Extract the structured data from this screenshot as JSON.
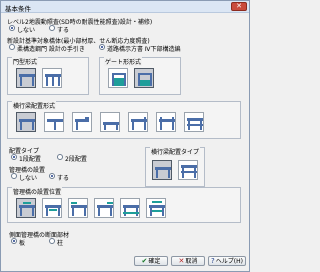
{
  "window": {
    "title": "基本条件",
    "close_glyph": "✕"
  },
  "level_check": {
    "label": "レベル2地震動照査(SD時の耐震性能照査)設計・補修)",
    "options": [
      "しない",
      "する"
    ],
    "selected": 0
  },
  "seismic": {
    "label": "新設計基準対象橋体(最小部材厚、せん断応力度照査)",
    "options": [
      "柔構造鋼門 設計の手引き",
      "道路橋示方書 Ⅳ下部構造編"
    ],
    "selected": 1
  },
  "pier_type": {
    "label": "門型形式"
  },
  "gate_type": {
    "label": "ゲート形形式"
  },
  "beam_type": {
    "label": "横行梁配置形式"
  },
  "haichi_type": {
    "label": "配置タイプ",
    "options": [
      "1段配置",
      "2段配置"
    ],
    "selected": 0
  },
  "beam_layout_type": {
    "label": "横行梁配置タイプ"
  },
  "beam_tube": {
    "label": "管理橋の設置",
    "options": [
      "しない",
      "する"
    ],
    "selected": 1
  },
  "beam_tube_pos": {
    "label": "管理橋の設置位置"
  },
  "side_member": {
    "label": "側面管理橋の断面部材",
    "options": [
      "板",
      "柱"
    ],
    "selected": 0
  },
  "buttons": {
    "ok": "確定",
    "cancel": "取消",
    "help": "ヘルプ(H)"
  },
  "colors": {
    "accent": "#1f3d8a",
    "teal": "#1e9e9a",
    "tile_fill": "#4b6ea8"
  }
}
